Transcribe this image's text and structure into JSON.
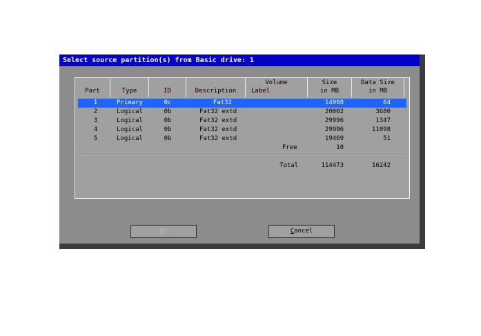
{
  "dialog": {
    "title": "Select source partition(s) from Basic drive: 1"
  },
  "table": {
    "headers": {
      "part": "Part",
      "type": "Type",
      "id": "ID",
      "description": "Description",
      "volume_1": "Volume",
      "volume_2": "Label",
      "size_1": "Size",
      "size_2": "in MB",
      "datasize_1": "Data Size",
      "datasize_2": "in MB"
    },
    "rows": [
      {
        "part": "1",
        "type": "Primary",
        "id": "0c",
        "description": "Fat32",
        "label": "",
        "size": "14998",
        "data": "64",
        "selected": true
      },
      {
        "part": "2",
        "type": "Logical",
        "id": "0b",
        "description": "Fat32 extd",
        "label": "",
        "size": "20002",
        "data": "3680"
      },
      {
        "part": "3",
        "type": "Logical",
        "id": "0b",
        "description": "Fat32 extd",
        "label": "",
        "size": "29996",
        "data": "1347"
      },
      {
        "part": "4",
        "type": "Logical",
        "id": "0b",
        "description": "Fat32 extd",
        "label": "",
        "size": "29996",
        "data": "11098"
      },
      {
        "part": "5",
        "type": "Logical",
        "id": "0b",
        "description": "Fat32 extd",
        "label": "",
        "size": "19469",
        "data": "51"
      }
    ],
    "free": {
      "label": "Free",
      "size": "10"
    },
    "total": {
      "label": "Total",
      "size": "114473",
      "data": "16242"
    }
  },
  "buttons": {
    "ok_underline": "O",
    "ok_rest": "K",
    "cancel_underline": "C",
    "cancel_rest": "ancel"
  },
  "colors": {
    "titlebar": "#0000c8",
    "selection": "#1e64ff",
    "dialog_bg": "#8c8c8c"
  }
}
